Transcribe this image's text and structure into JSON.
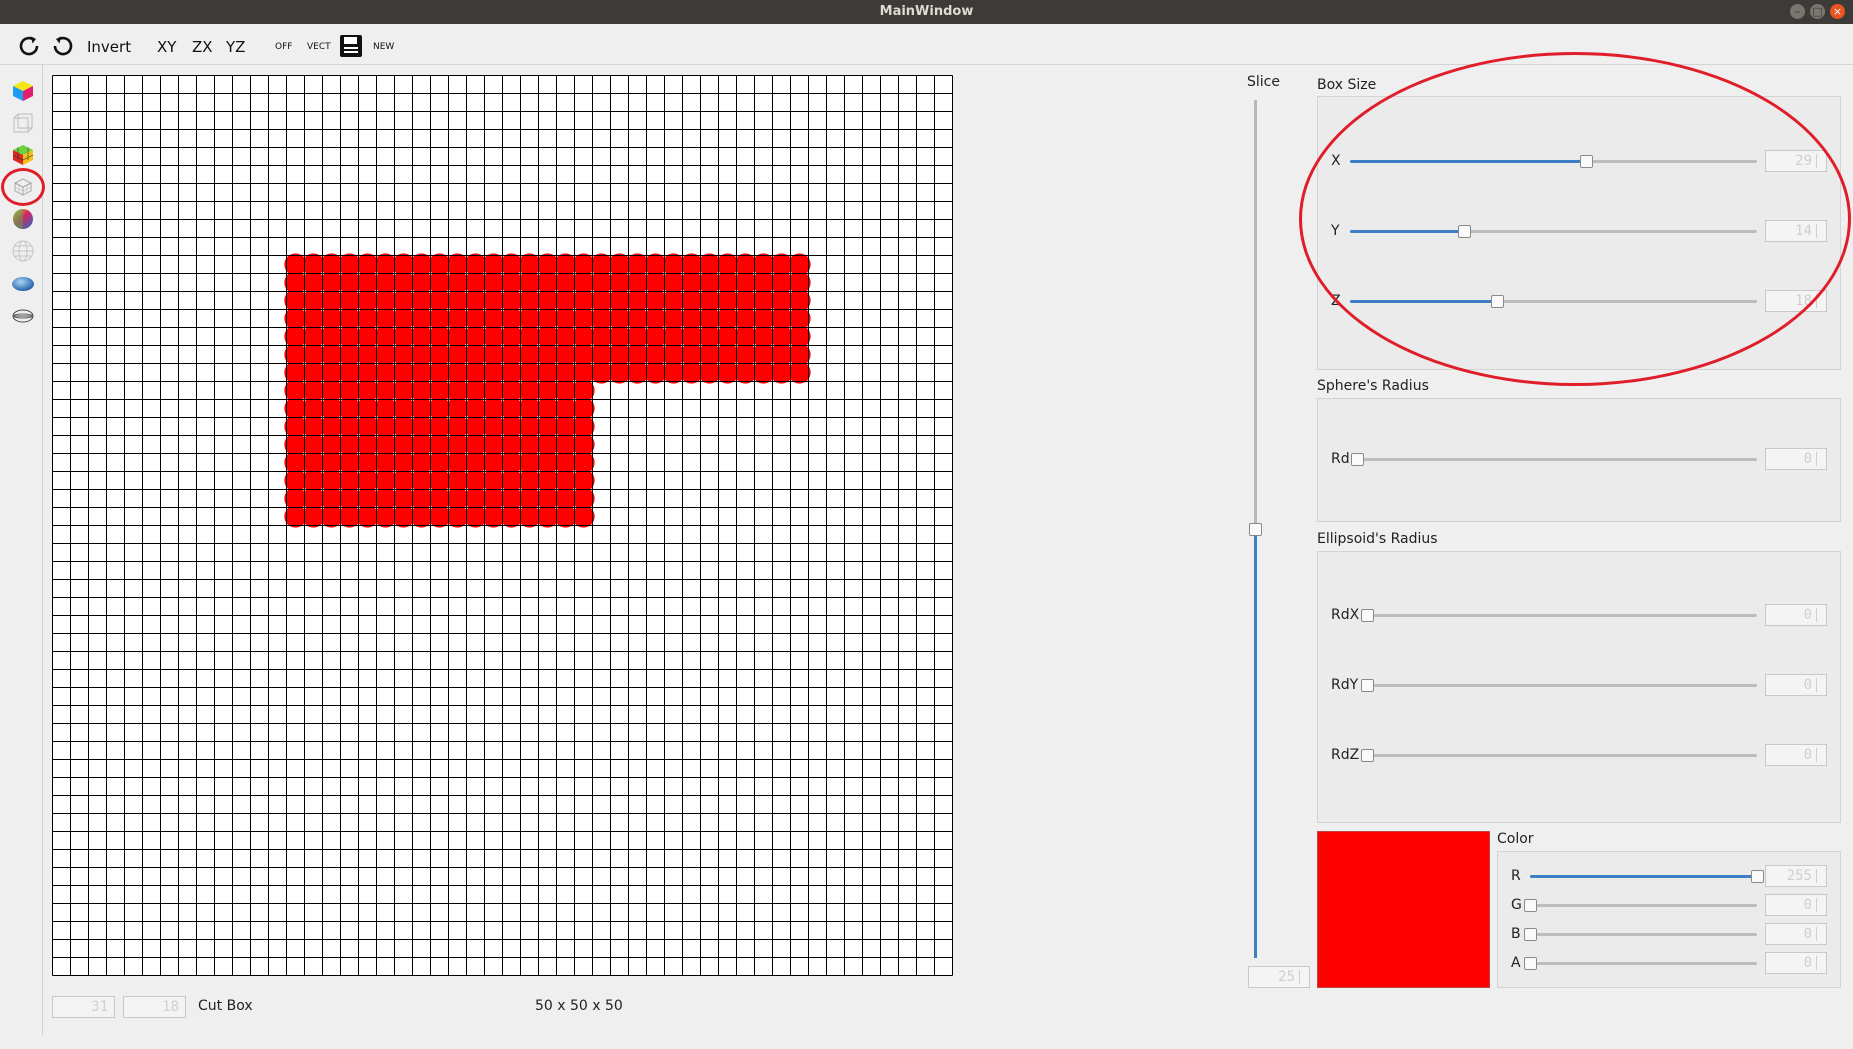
{
  "window": {
    "title": "MainWindow"
  },
  "toolbar": {
    "invert_label": "Invert",
    "xy_label": "XY",
    "zx_label": "ZX",
    "yz_label": "YZ",
    "off_label": "OFF",
    "vect_label": "VECT",
    "new_label": "NEW",
    "icons": [
      "redo-icon",
      "undo-icon",
      "save-file-icon"
    ]
  },
  "tools": [
    "color-cube-icon",
    "wire-box-icon",
    "rgb-cube-icon",
    "box-grid-icon",
    "color-sphere-icon",
    "wire-sphere-icon",
    "ellipsoid-icon",
    "wire-ellipsoid-icon"
  ],
  "selected_tool": "box-grid-icon",
  "grid": {
    "size": 50,
    "filled_color": "#ff0000",
    "filled_regions": [
      {
        "col_start": 13,
        "col_end": 41,
        "row_start": 10,
        "row_end": 16
      },
      {
        "col_start": 13,
        "col_end": 29,
        "row_start": 17,
        "row_end": 24
      }
    ]
  },
  "slice": {
    "label": "Slice",
    "value": 25,
    "max": 50,
    "spin": "25"
  },
  "box_size": {
    "title": "Box Size",
    "x": {
      "label": "X",
      "value": 29,
      "max": 50,
      "spin": "29"
    },
    "y": {
      "label": "Y",
      "value": 14,
      "max": 50,
      "spin": "14"
    },
    "z": {
      "label": "Z",
      "value": 18,
      "max": 50,
      "spin": "18"
    }
  },
  "sphere": {
    "title": "Sphere's Radius",
    "rd": {
      "label": "Rd",
      "value": 0,
      "max": 50,
      "spin": "0"
    }
  },
  "ellipsoid": {
    "title": "Ellipsoid's Radius",
    "rdx": {
      "label": "RdX",
      "value": 0,
      "max": 50,
      "spin": "0"
    },
    "rdy": {
      "label": "RdY",
      "value": 0,
      "max": 50,
      "spin": "0"
    },
    "rdz": {
      "label": "RdZ",
      "value": 0,
      "max": 50,
      "spin": "0"
    }
  },
  "color": {
    "title": "Color",
    "swatch": "#ff0000",
    "r": {
      "label": "R",
      "value": 255,
      "max": 255,
      "spin": "255"
    },
    "g": {
      "label": "G",
      "value": 0,
      "max": 255,
      "spin": "0"
    },
    "b": {
      "label": "B",
      "value": 0,
      "max": 255,
      "spin": "0"
    },
    "a": {
      "label": "A",
      "value": 0,
      "max": 255,
      "spin": "0"
    }
  },
  "bottom": {
    "field1": "31",
    "field2": "18",
    "cut_box_label": "Cut Box",
    "dims": "50 x 50 x 50"
  }
}
